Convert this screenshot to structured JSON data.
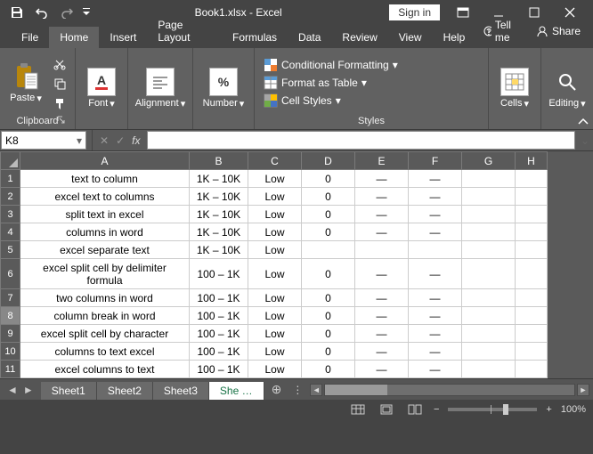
{
  "title": "Book1.xlsx - Excel",
  "signin": "Sign in",
  "tabs": [
    "File",
    "Home",
    "Insert",
    "Page Layout",
    "Formulas",
    "Data",
    "Review",
    "View",
    "Help"
  ],
  "tellme": "Tell me",
  "share": "Share",
  "ribbon": {
    "paste": "Paste",
    "clipboard": "Clipboard",
    "font": "Font",
    "alignment": "Alignment",
    "number": "Number",
    "styles": "Styles",
    "cond_fmt": "Conditional Formatting",
    "fmt_table": "Format as Table",
    "cell_styles": "Cell Styles",
    "cells": "Cells",
    "editing": "Editing",
    "font_glyph": "A",
    "number_glyph": "%"
  },
  "namebox": "K8",
  "fx_label": "fx",
  "columns": [
    "A",
    "B",
    "C",
    "D",
    "E",
    "F",
    "G",
    "H"
  ],
  "rows": [
    {
      "n": "1",
      "a": "text to column",
      "b": "1K – 10K",
      "c": "Low",
      "d": "0",
      "e": "—",
      "f": "—",
      "tall": false
    },
    {
      "n": "2",
      "a": "excel text to columns",
      "b": "1K – 10K",
      "c": "Low",
      "d": "0",
      "e": "—",
      "f": "—",
      "tall": false
    },
    {
      "n": "3",
      "a": "split text in excel",
      "b": "1K – 10K",
      "c": "Low",
      "d": "0",
      "e": "—",
      "f": "—",
      "tall": false
    },
    {
      "n": "4",
      "a": "columns in word",
      "b": "1K – 10K",
      "c": "Low",
      "d": "0",
      "e": "—",
      "f": "—",
      "tall": false
    },
    {
      "n": "5",
      "a": "excel separate text",
      "b": "1K – 10K",
      "c": "Low",
      "d": "",
      "e": "",
      "f": "",
      "tall": false
    },
    {
      "n": "6",
      "a": "excel split cell by delimiter formula",
      "b": "100 – 1K",
      "c": "Low",
      "d": "0",
      "e": "—",
      "f": "—",
      "tall": true
    },
    {
      "n": "7",
      "a": "two columns in word",
      "b": "100 – 1K",
      "c": "Low",
      "d": "0",
      "e": "—",
      "f": "—",
      "tall": false
    },
    {
      "n": "8",
      "a": "column break in word",
      "b": "100 – 1K",
      "c": "Low",
      "d": "0",
      "e": "—",
      "f": "—",
      "tall": false,
      "sel": true
    },
    {
      "n": "9",
      "a": "excel split cell by character",
      "b": "100 – 1K",
      "c": "Low",
      "d": "0",
      "e": "—",
      "f": "—",
      "tall": false
    },
    {
      "n": "10",
      "a": "columns to text excel",
      "b": "100 – 1K",
      "c": "Low",
      "d": "0",
      "e": "—",
      "f": "—",
      "tall": false
    },
    {
      "n": "11",
      "a": "excel columns to text",
      "b": "100 – 1K",
      "c": "Low",
      "d": "0",
      "e": "—",
      "f": "—",
      "tall": false
    }
  ],
  "sheets": [
    "Sheet1",
    "Sheet2",
    "Sheet3"
  ],
  "active_sheet_trunc": "She …",
  "zoom": "100%"
}
